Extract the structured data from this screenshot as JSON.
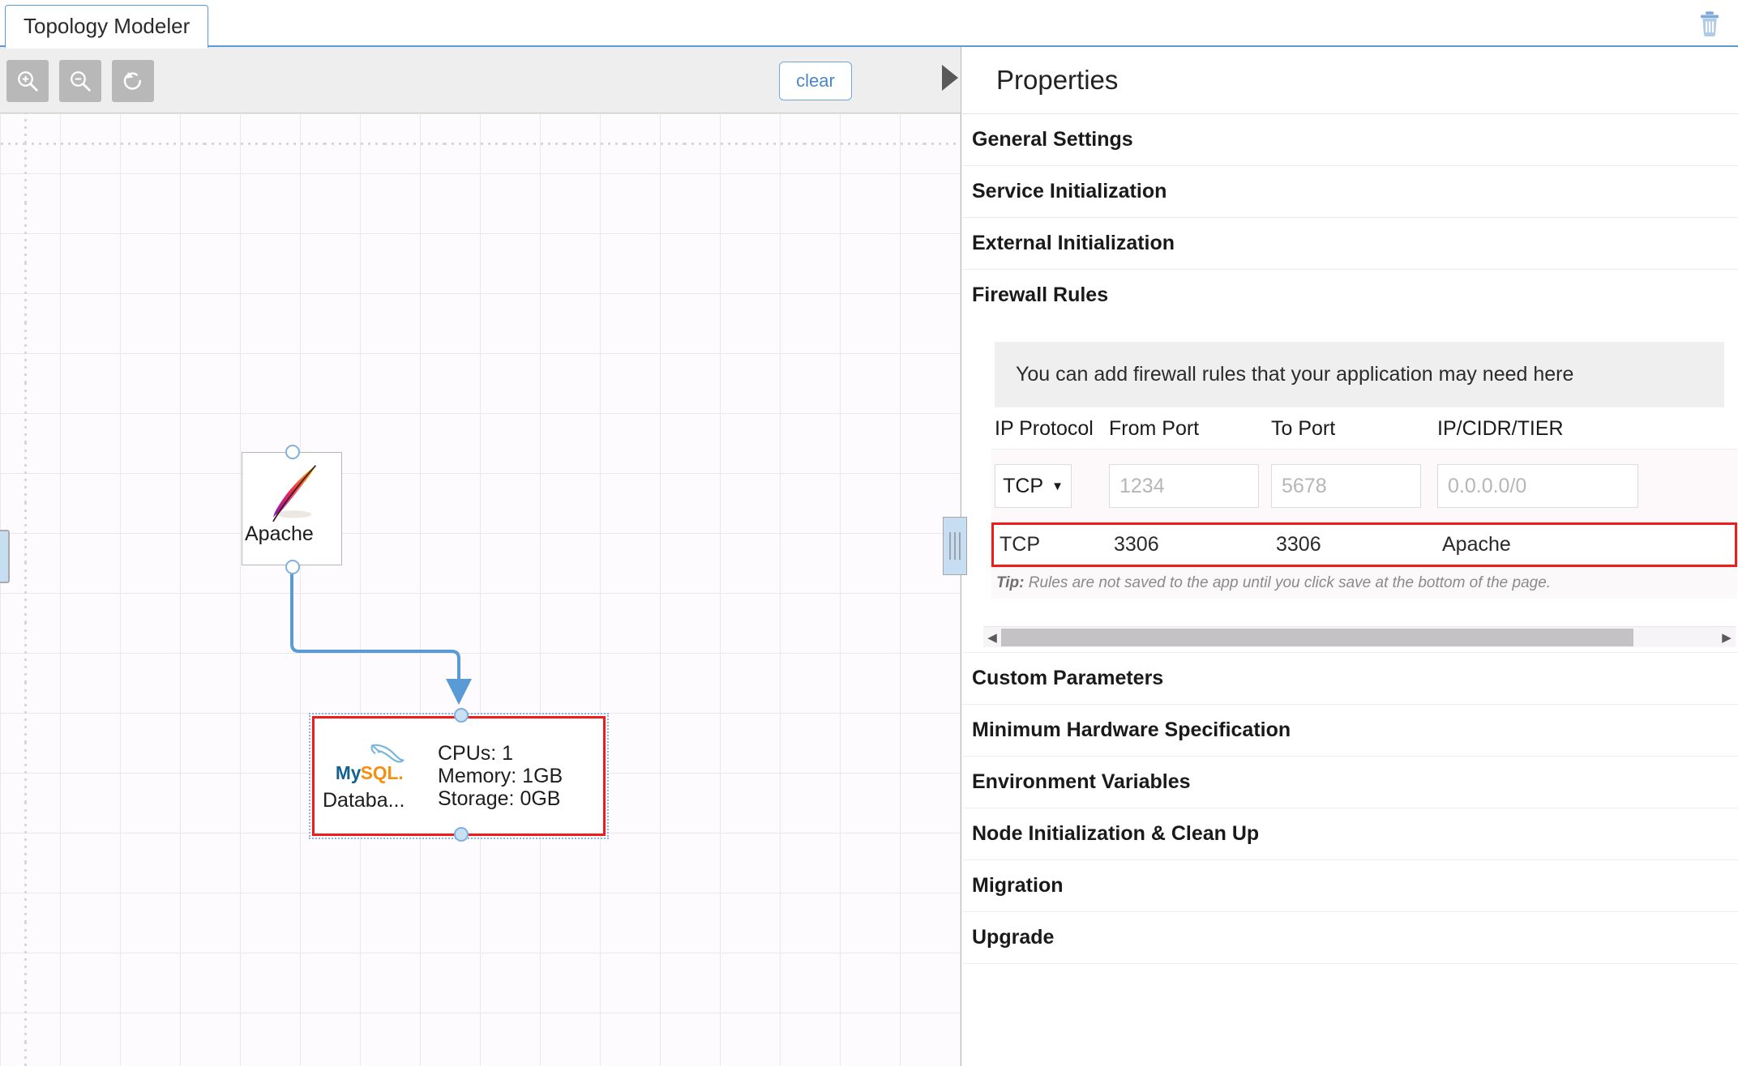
{
  "tab": {
    "label": "Topology Modeler"
  },
  "header": {
    "delete_icon": "trash-icon"
  },
  "canvas": {
    "toolbar": {
      "zoom_in": "zoom-in-icon",
      "zoom_out": "zoom-out-icon",
      "reset": "reset-icon",
      "clear_label": "clear",
      "collapse_icon": "collapse-right-arrow-icon"
    },
    "nodes": [
      {
        "id": "apache",
        "label": "Apache",
        "icon": "apache-feather-icon",
        "selected": false
      },
      {
        "id": "database",
        "label": "Databa...",
        "icon": "mysql-dolphin-icon",
        "selected": true,
        "specs": {
          "cpus": "CPUs: 1",
          "memory": "Memory: 1GB",
          "storage": "Storage: 0GB"
        }
      }
    ],
    "selection_color": "#f01c1c",
    "link_color": "#5b9bd5"
  },
  "properties": {
    "title": "Properties",
    "sections": [
      {
        "label": "General Settings",
        "expanded": false
      },
      {
        "label": "Service Initialization",
        "expanded": false
      },
      {
        "label": "External Initialization",
        "expanded": false
      },
      {
        "label": "Firewall Rules",
        "expanded": true
      },
      {
        "label": "Custom Parameters",
        "expanded": false
      },
      {
        "label": "Minimum Hardware Specification",
        "expanded": false
      },
      {
        "label": "Environment Variables",
        "expanded": false
      },
      {
        "label": "Node Initialization & Clean Up",
        "expanded": false
      },
      {
        "label": "Migration",
        "expanded": false
      },
      {
        "label": "Upgrade",
        "expanded": false
      }
    ],
    "firewall": {
      "banner": "You can add firewall rules that your application may need here",
      "columns": [
        "IP Protocol",
        "From Port",
        "To Port",
        "IP/CIDR/TIER"
      ],
      "new_rule": {
        "protocol_value": "TCP",
        "protocol_caret": "▼",
        "from_port_placeholder": "1234",
        "to_port_placeholder": "5678",
        "cidr_placeholder": "0.0.0.0/0"
      },
      "rows": [
        {
          "protocol": "TCP",
          "from_port": "3306",
          "to_port": "3306",
          "target": "Apache",
          "highlighted": true
        }
      ],
      "tip_label": "Tip:",
      "tip_text": " Rules are not saved to the app until you click save at the bottom of the page.",
      "scroll_left_icon": "◀",
      "scroll_right_icon": "▶"
    }
  }
}
